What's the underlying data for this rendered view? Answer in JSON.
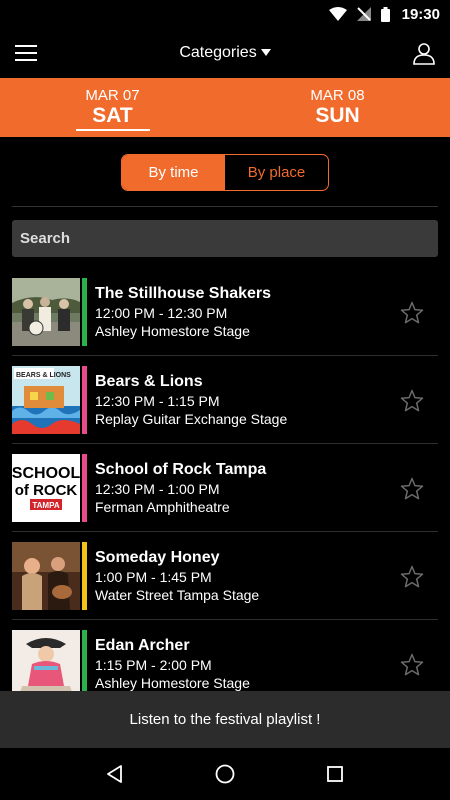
{
  "status": {
    "time": "19:30"
  },
  "app_bar": {
    "categories_label": "Categories"
  },
  "days": [
    {
      "date": "MAR 07",
      "day": "SAT",
      "active": true
    },
    {
      "date": "MAR 08",
      "day": "SUN",
      "active": false
    }
  ],
  "view_toggle": {
    "by_time": "By time",
    "by_place": "By place",
    "active": "by_time"
  },
  "search": {
    "placeholder": "Search"
  },
  "events": [
    {
      "name": "The Stillhouse Shakers",
      "time": "12:00 PM - 12:30 PM",
      "stage": "Ashley Homestore Stage",
      "color": "#2db24a"
    },
    {
      "name": "Bears & Lions",
      "time": "12:30 PM - 1:15 PM",
      "stage": "Replay Guitar Exchange Stage",
      "color": "#e84b8a"
    },
    {
      "name": "School of Rock Tampa",
      "time": "12:30 PM - 1:00 PM",
      "stage": "Ferman Amphitheatre",
      "color": "#e84b8a"
    },
    {
      "name": "Someday Honey",
      "time": "1:00 PM - 1:45 PM",
      "stage": "Water Street Tampa Stage",
      "color": "#f2c21b"
    },
    {
      "name": "Edan Archer",
      "time": "1:15 PM - 2:00 PM",
      "stage": "Ashley Homestore Stage",
      "color": "#2db24a"
    }
  ],
  "thumb_text": {
    "school_line1": "SCHOOL",
    "school_line2": "of ROCK",
    "school_line3": "TAMPA",
    "bears": "BEARS & LIONS"
  },
  "playlist": {
    "label": "Listen to the festival playlist !"
  },
  "colors": {
    "accent": "#f06b2c",
    "background": "#000000",
    "search_bg": "#3a3a3a",
    "playlist_bg": "#2c2c2c"
  }
}
